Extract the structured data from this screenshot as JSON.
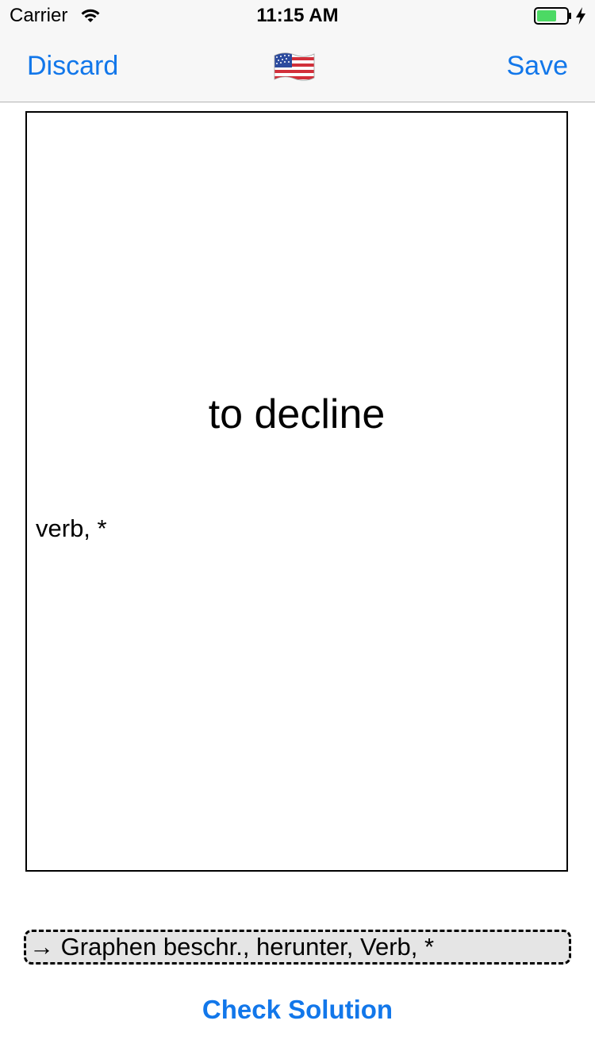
{
  "status_bar": {
    "carrier": "Carrier",
    "time": "11:15 AM",
    "wifi_icon": "wifi-icon",
    "battery_icon": "battery-icon",
    "charging_icon": "bolt-icon"
  },
  "nav_bar": {
    "discard_label": "Discard",
    "save_label": "Save",
    "flag_icon": "us-flag-icon"
  },
  "card": {
    "term": "to decline",
    "note": "verb, *"
  },
  "answer": {
    "value": "→ Graphen beschr., herunter, Verb, *"
  },
  "check_solution_label": "Check Solution",
  "colors": {
    "accent": "#1277ea",
    "bar_background": "#f7f7f7",
    "answer_background": "#e5e5e5",
    "battery_fill": "#4cd964"
  }
}
